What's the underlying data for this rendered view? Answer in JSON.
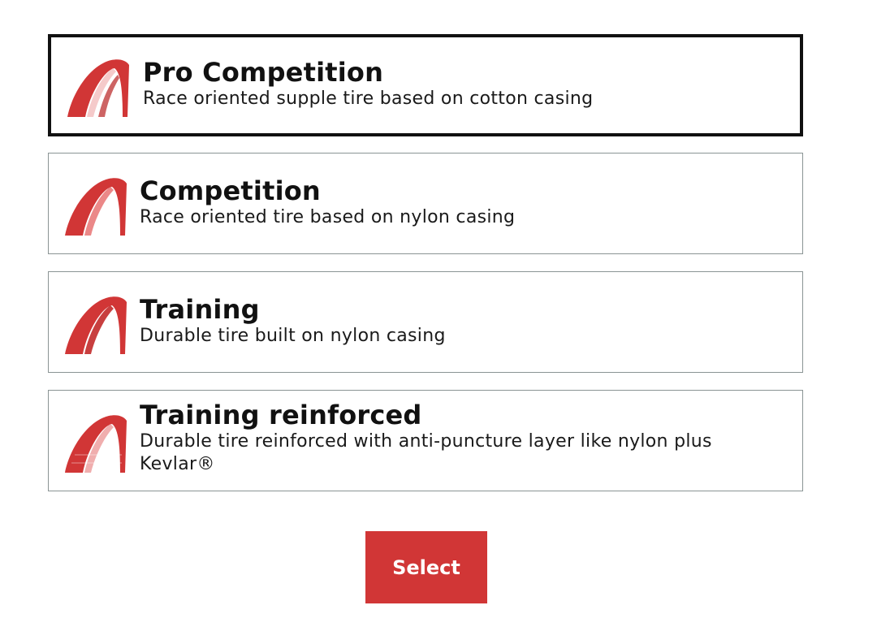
{
  "options": [
    {
      "title": "Pro Competition",
      "description": "Race oriented supple tire based on cotton casing",
      "selected": true,
      "icon": "tire-icon"
    },
    {
      "title": "Competition",
      "description": "Race oriented tire based on nylon casing",
      "selected": false,
      "icon": "tire-icon"
    },
    {
      "title": "Training",
      "description": "Durable tire built on nylon casing",
      "selected": false,
      "icon": "tire-icon"
    },
    {
      "title": "Training reinforced",
      "description": "Durable tire reinforced with anti-puncture layer like nylon plus Kevlar®",
      "selected": false,
      "icon": "tire-icon"
    }
  ],
  "select_button": {
    "label": "Select"
  },
  "colors": {
    "accent": "#d13636",
    "selected_border": "#111111",
    "option_border": "#8a9494"
  }
}
